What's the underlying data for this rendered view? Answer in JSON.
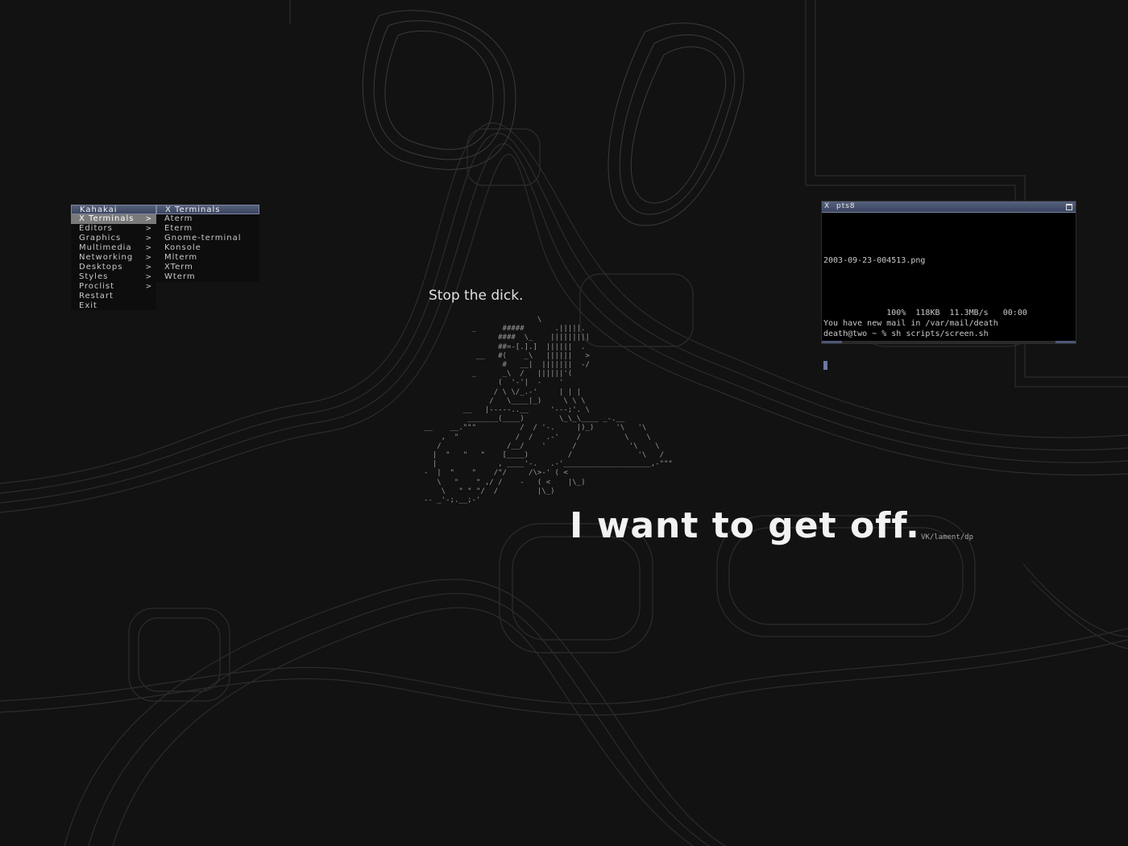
{
  "root_menu": {
    "title": "Kahakai",
    "items": [
      {
        "label": "X Terminals",
        "submenu": true,
        "active": true
      },
      {
        "label": "Editors",
        "submenu": true
      },
      {
        "label": "Graphics",
        "submenu": true
      },
      {
        "label": "Multimedia",
        "submenu": true
      },
      {
        "label": "Networking",
        "submenu": true
      },
      {
        "label": "Desktops",
        "submenu": true
      },
      {
        "label": "Styles",
        "submenu": true
      },
      {
        "label": "Proclist",
        "submenu": true
      },
      {
        "label": "Restart",
        "submenu": false
      },
      {
        "label": "Exit",
        "submenu": false
      }
    ]
  },
  "sub_menu": {
    "title": "X Terminals",
    "items": [
      "Aterm",
      "Eterm",
      "Gnome-terminal",
      "Konsole",
      "Mlterm",
      "XTerm",
      "Wterm"
    ]
  },
  "terminal": {
    "close_glyph": "X",
    "title": "pts8",
    "lines": [
      "",
      "2003-09-23-004513.png",
      "",
      "",
      "",
      "",
      "             100%  118KB  11.3MB/s   00:00",
      "You have new mail in /var/mail/death",
      "death@two ~ % sh scripts/screen.sh"
    ]
  },
  "desktop": {
    "caption": "Stop the dick.",
    "headline": "I want to get off.",
    "credit": "VK/lament/dp",
    "ascii_art": "                          \\\n           _      #####       .|||||.\n                 ####  \\_    |||||||||\n                 ##=-[.].]  ||||||  .\n            __   #(    _\\   ||||||   >\n                  #   __|  |||||||  -/\n           _      _\\  /   ||||||'(\n                 (  '-'|  -    '\n                / \\ \\/_.-'     | | |\n               /   \\____|_)     \\ \\ \\\n         __   |-----..__     '---;'. \\\n          _______(____)        \\_\\_\\____ _-.__\n__    __.\"\"\"          /  / '-.     |)_)     '\\   '\\\n    ,  \"             /  /   .-'    /          \\    \\\n   /               /__/    '      /            '\\    \\\n  |  \"   \"   \"    [____)         /               '\\   /\n  |              , ____'-.   .-'____________________,-\"\"\"\n-  |  \"    \"    /\"/     /\\>-' ( <\n   \\   \"    \" ,/ /    -   ( <    |\\_)\n    \\   \" \" \"/  /         |\\_)\n-- _'-;.__;-'"
  },
  "colors": {
    "background": "#121212",
    "titlebar": "#4a5470",
    "menu_active": "#7a7a7a",
    "wallpaper_lines": "#2e2e2e"
  }
}
